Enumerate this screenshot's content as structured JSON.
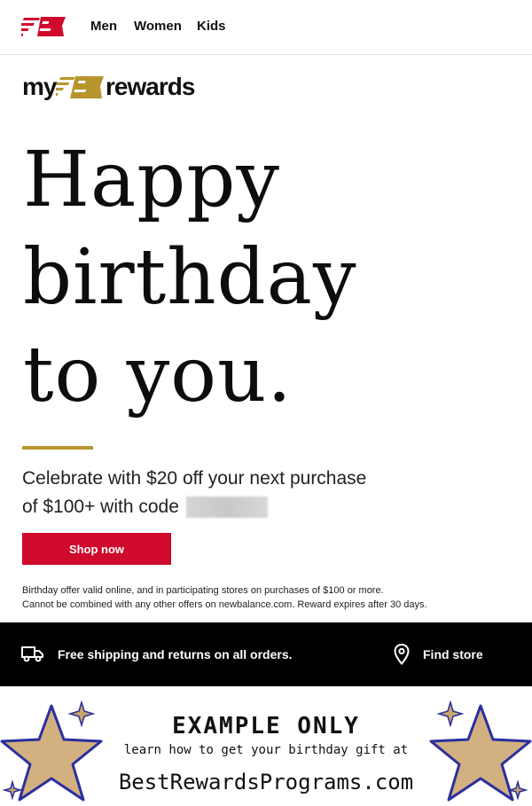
{
  "header": {
    "logo_icon": "new-balance-logo-icon",
    "nav": [
      {
        "label": "Men"
      },
      {
        "label": "Women"
      },
      {
        "label": "Kids"
      }
    ]
  },
  "rewards_logo": {
    "my": "my",
    "rewards": "rewards"
  },
  "headline": [
    "Happy",
    "birthday",
    "to you."
  ],
  "offer": {
    "line1": "Celebrate with $20 off your next purchase",
    "line2": "of $100+ with code"
  },
  "cta": {
    "shop_label": "Shop now"
  },
  "fineprint": [
    "Birthday offer valid online, and in participating stores on purchases of $100 or more.",
    "Cannot be combined with any other offers on newbalance.com. Reward expires after 30 days."
  ],
  "service_bar": {
    "shipping_text": "Free shipping and returns on all orders.",
    "store_label": "Find store",
    "icons": [
      "truck-icon",
      "location-pin-icon"
    ]
  },
  "example_banner": {
    "title": "EXAMPLE ONLY",
    "subtitle": "learn how to get your birthday gift at",
    "site": "BestRewardsPrograms.com"
  },
  "colors": {
    "brand_red": "#cf0a2c",
    "gold": "#b8952c",
    "black": "#000000",
    "star_fill": "#d2b080",
    "star_outline": "#2b2f9e"
  }
}
